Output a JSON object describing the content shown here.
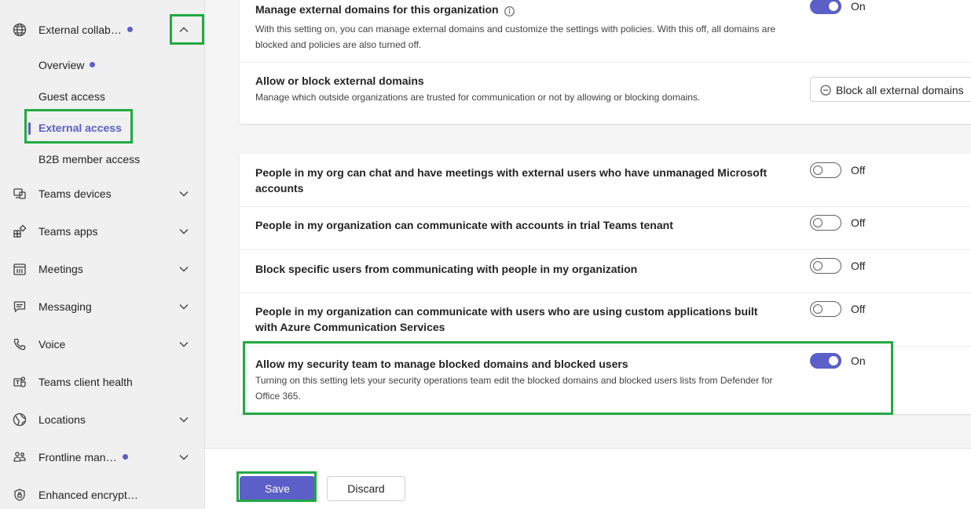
{
  "sidebar": {
    "external_collab": {
      "label": "External collab…",
      "icon": "globe-icon"
    },
    "sub_items": [
      {
        "label": "Overview"
      },
      {
        "label": "Guest access"
      },
      {
        "label": "External access"
      },
      {
        "label": "B2B member access"
      }
    ],
    "items": [
      {
        "label": "Teams devices",
        "icon": "devices-icon"
      },
      {
        "label": "Teams apps",
        "icon": "apps-icon"
      },
      {
        "label": "Meetings",
        "icon": "calendar-icon"
      },
      {
        "label": "Messaging",
        "icon": "chat-icon"
      },
      {
        "label": "Voice",
        "icon": "phone-icon"
      },
      {
        "label": "Teams client health",
        "icon": "teams-health-icon"
      },
      {
        "label": "Locations",
        "icon": "globe-location-icon"
      },
      {
        "label": "Frontline man…",
        "icon": "people-icon"
      },
      {
        "label": "Enhanced encrypt…",
        "icon": "shield-icon"
      }
    ],
    "accent_color": "#5b5fc7"
  },
  "settings": {
    "manage_domains": {
      "title": "Manage external domains for this organization",
      "desc": "With this setting on, you can manage external domains and customize the settings with policies. With this off, all domains are blocked and policies are also turned off.",
      "state": "On"
    },
    "allow_block": {
      "title": "Allow or block external domains",
      "desc": "Manage which outside organizations are trusted for communication or not by allowing or blocking domains.",
      "button": "Block all external domains"
    },
    "unmanaged": {
      "title": "People in my org can chat and have meetings with external users who have unmanaged Microsoft accounts",
      "state": "Off"
    },
    "trial": {
      "title": "People in my organization can communicate with accounts in trial Teams tenant",
      "state": "Off"
    },
    "block_users": {
      "title": "Block specific users from communicating with people in my organization",
      "state": "Off"
    },
    "acs": {
      "title": "People in my organization can communicate with users who are using custom applications built with Azure Communication Services",
      "state": "Off"
    },
    "security_team": {
      "title": "Allow my security team to manage blocked domains and blocked users",
      "desc": "Turning on this setting lets your security operations team edit the blocked domains and blocked users lists from Defender for Office 365.",
      "state": "On"
    }
  },
  "footer": {
    "save": "Save",
    "discard": "Discard"
  }
}
